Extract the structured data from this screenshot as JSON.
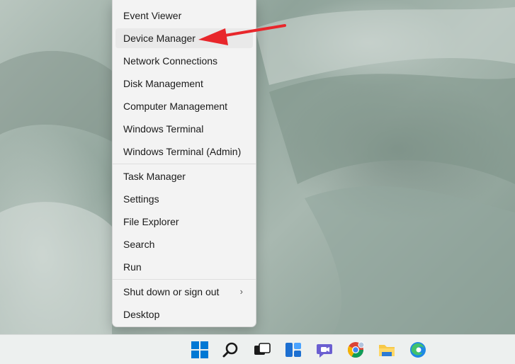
{
  "menu": {
    "groups": [
      [
        {
          "label": "Event Viewer"
        },
        {
          "label": "Device Manager"
        },
        {
          "label": "Network Connections"
        },
        {
          "label": "Disk Management"
        },
        {
          "label": "Computer Management"
        },
        {
          "label": "Windows Terminal"
        },
        {
          "label": "Windows Terminal (Admin)"
        }
      ],
      [
        {
          "label": "Task Manager"
        },
        {
          "label": "Settings"
        },
        {
          "label": "File Explorer"
        },
        {
          "label": "Search"
        },
        {
          "label": "Run"
        }
      ],
      [
        {
          "label": "Shut down or sign out"
        },
        {
          "label": "Desktop"
        }
      ]
    ],
    "highlighted": "Device Manager",
    "submenu_chevron": "›"
  },
  "annotation": {
    "arrow_color": "#e8262b"
  },
  "taskbar": {
    "icons": [
      "windows-start-icon",
      "search-icon",
      "task-view-icon",
      "widgets-icon",
      "teams-chat-icon",
      "chrome-icon",
      "file-explorer-icon",
      "edge-icon"
    ]
  },
  "colors": {
    "menu_bg": "#f3f3f3",
    "highlight": "#e9e9e9",
    "accent": "#0067c0"
  }
}
